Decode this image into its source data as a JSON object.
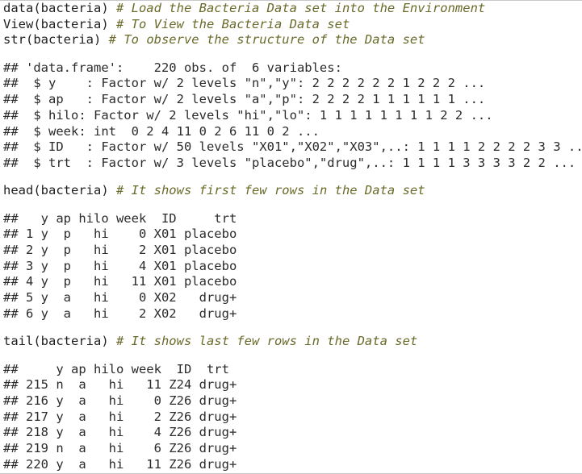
{
  "code_block_1": [
    {
      "code": "data(bacteria) ",
      "comment": "# Load the Bacteria Data set into the Environment"
    },
    {
      "code": "View(bacteria) ",
      "comment": "# To View the Bacteria Data set"
    },
    {
      "code": "str(bacteria) ",
      "comment": "# To observe the structure of the Data set"
    }
  ],
  "output_block_1": [
    "## 'data.frame':    220 obs. of  6 variables:",
    "##  $ y    : Factor w/ 2 levels \"n\",\"y\": 2 2 2 2 2 2 1 2 2 2 ...",
    "##  $ ap   : Factor w/ 2 levels \"a\",\"p\": 2 2 2 2 1 1 1 1 1 1 ...",
    "##  $ hilo: Factor w/ 2 levels \"hi\",\"lo\": 1 1 1 1 1 1 1 1 2 2 ...",
    "##  $ week: int  0 2 4 11 0 2 6 11 0 2 ...",
    "##  $ ID   : Factor w/ 50 levels \"X01\",\"X02\",\"X03\",..: 1 1 1 1 2 2 2 2 3 3 ...",
    "##  $ trt  : Factor w/ 3 levels \"placebo\",\"drug\",..: 1 1 1 1 3 3 3 3 2 2 ..."
  ],
  "code_block_2": [
    {
      "code": "head(bacteria) ",
      "comment": "# It shows first few rows in the Data set"
    }
  ],
  "output_block_2": [
    "##   y ap hilo week  ID     trt",
    "## 1 y  p   hi    0 X01 placebo",
    "## 2 y  p   hi    2 X01 placebo",
    "## 3 y  p   hi    4 X01 placebo",
    "## 4 y  p   hi   11 X01 placebo",
    "## 5 y  a   hi    0 X02   drug+",
    "## 6 y  a   hi    2 X02   drug+"
  ],
  "code_block_3": [
    {
      "code": "tail(bacteria) ",
      "comment": "# It shows last few rows in the Data set"
    }
  ],
  "output_block_3": [
    "##     y ap hilo week  ID  trt",
    "## 215 n  a   hi   11 Z24 drug+",
    "## 216 y  a   hi    0 Z26 drug+",
    "## 217 y  a   hi    2 Z26 drug+",
    "## 218 y  a   hi    4 Z26 drug+",
    "## 219 n  a   hi    6 Z26 drug+",
    "## 220 y  a   hi   11 Z26 drug+"
  ]
}
